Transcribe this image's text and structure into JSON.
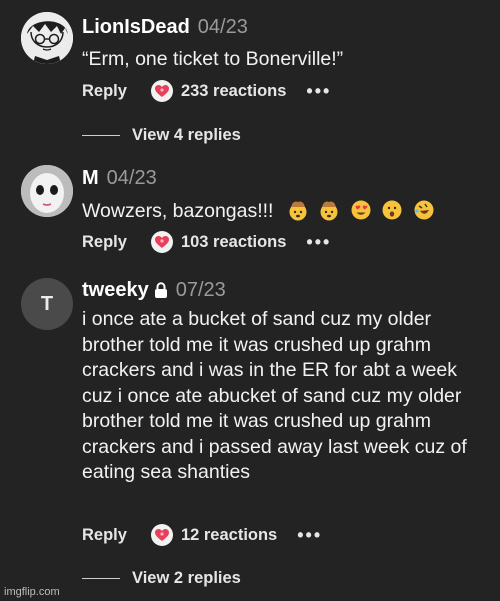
{
  "comments": [
    {
      "username": "LionIsDead",
      "date": "04/23",
      "text": "“Erm, one ticket to Bonerville!”",
      "reply_label": "Reply",
      "reactions": "233 reactions",
      "more": "•••",
      "avatar": "manga-face",
      "view_replies": "View 4 replies"
    },
    {
      "username": "M",
      "date": "04/23",
      "text": "Wowzers, bazongas!!!",
      "emojis": [
        "exploding-head",
        "exploding-head",
        "heart-eyes",
        "anguished-face",
        "rolling-on-floor-laughing"
      ],
      "reply_label": "Reply",
      "reactions": "103 reactions",
      "more": "•••",
      "avatar": "pale-doll-face"
    },
    {
      "username": "tweeky",
      "date": "07/23",
      "avatar_letter": "T",
      "lock_icon": "lock-icon",
      "text": "i once ate a bucket of sand cuz my older brother told me it was crushed up grahm crackers and i was in the ER for abt a week cuz i once ate abucket of sand cuz my older brother told me it was crushed up grahm crackers and i passed away last week cuz of eating sea shanties",
      "reply_label": "Reply",
      "reactions": "12 reactions",
      "more": "•••",
      "view_replies": "View 2 replies"
    }
  ],
  "watermark": "imgflip.com",
  "colors": {
    "background": "#232323",
    "text": "#ffffff",
    "muted": "#9a9a9a",
    "heart": "#e8405a"
  }
}
